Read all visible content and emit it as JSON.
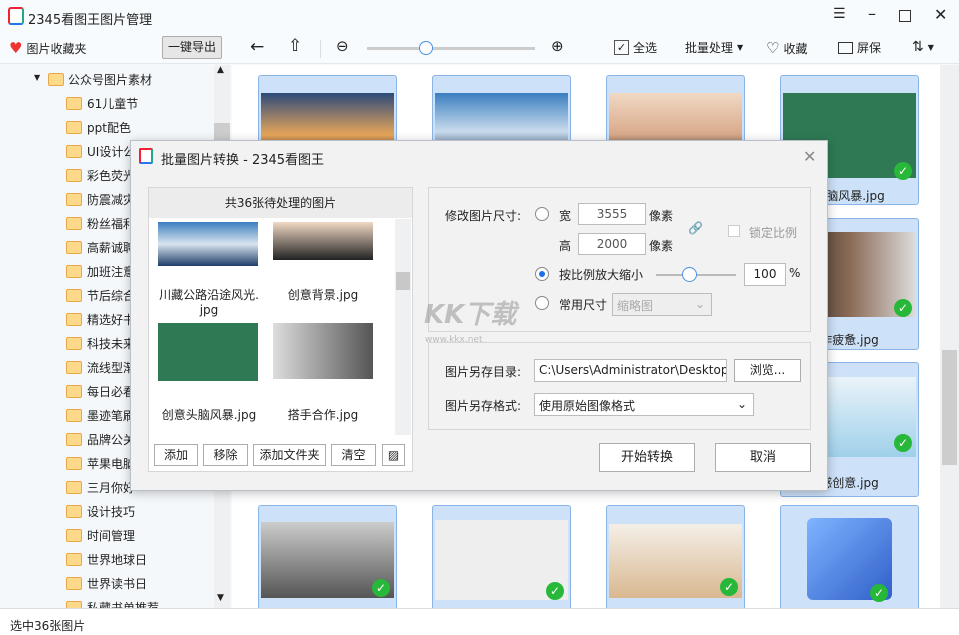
{
  "app": {
    "title": "2345看图王图片管理",
    "window_controls": [
      "menu",
      "minimize",
      "maximize",
      "close"
    ]
  },
  "toolbar": {
    "favorites": "图片收藏夹",
    "export": "一键导出",
    "zoom_level": 0.35,
    "select_all": "全选",
    "batch": "批量处理",
    "collect": "收藏",
    "screensaver": "屏保"
  },
  "sidebar": {
    "root": "公众号图片素材",
    "folders": [
      "61儿童节",
      "ppt配色",
      "UI设计公",
      "彩色荧光",
      "防震减灾",
      "粉丝福利",
      "高薪诚聘",
      "加班注意",
      "节后综合",
      "精选好书",
      "科技未来",
      "流线型渐",
      "每日必看",
      "墨迹笔刷",
      "品牌公关",
      "苹果电脑",
      "三月你好",
      "设计技巧",
      "时间管理",
      "世界地球日",
      "世界读书日",
      "私藏书单推荐"
    ]
  },
  "grid": {
    "labels": [
      "头脑风暴.jpg",
      "作疲惫.jpg",
      "感创意.jpg"
    ]
  },
  "status": "选中36张图片",
  "dialog": {
    "title": "批量图片转换 - 2345看图王",
    "list_header": "共36张待处理的图片",
    "items": [
      {
        "name": "川藏公路沿途风光.",
        "name2": "jpg"
      },
      {
        "name": "创意背景.jpg"
      },
      {
        "name": "创意头脑风暴.jpg"
      },
      {
        "name": "搭手合作.jpg"
      }
    ],
    "buttons": {
      "add": "添加",
      "remove": "移除",
      "add_folder": "添加文件夹",
      "clear": "清空",
      "start": "开始转换",
      "cancel": "取消",
      "browse": "浏览..."
    },
    "resize_label": "修改图片尺寸:",
    "width_label": "宽",
    "width": "3555",
    "height_label": "高",
    "height": "2000",
    "unit": "像素",
    "lock_ratio": "锁定比例",
    "scale_label": "按比例放大缩小",
    "scale_value": "100",
    "percent": "%",
    "common_label": "常用尺寸",
    "common_value": "缩略图",
    "dir_label": "图片另存目录:",
    "dir_value": "C:\\Users\\Administrator\\Desktop",
    "format_label": "图片另存格式:",
    "format_value": "使用原始图像格式"
  },
  "watermark": {
    "text": "KK下载",
    "url": "www.kkx.net"
  }
}
